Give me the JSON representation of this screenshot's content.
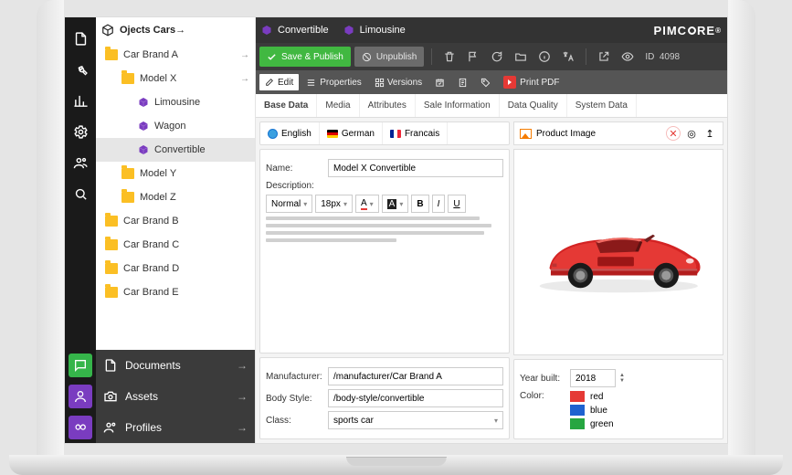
{
  "brand": "PIMCORE",
  "rail": {
    "items": [
      "file",
      "wrench",
      "chart",
      "settings",
      "users",
      "search"
    ],
    "bottom": [
      {
        "icon": "message",
        "color": "#35b54a"
      },
      {
        "icon": "user",
        "color": "#7a3cc0"
      },
      {
        "icon": "infinity",
        "color": "#7a3cc0"
      }
    ]
  },
  "tree": {
    "root": "Ojects Cars",
    "brand_a": "Car Brand A",
    "model_x": "Model X",
    "variants": [
      "Limousine",
      "Wagon",
      "Convertible"
    ],
    "models": [
      "Model Y",
      "Model Z"
    ],
    "brands": [
      "Car Brand B",
      "Car Brand C",
      "Car Brand D",
      "Car Brand E"
    ],
    "bottom": [
      {
        "label": "Documents",
        "icon": "document",
        "color": "#3b3b3b"
      },
      {
        "label": "Assets",
        "icon": "camera",
        "color": "#3b3b3b"
      },
      {
        "label": "Profiles",
        "icon": "profiles",
        "color": "#3b3b3b"
      }
    ]
  },
  "open_tabs": [
    "Convertible",
    "Limousine"
  ],
  "toolbar": {
    "save": "Save & Publish",
    "unpublish": "Unpublish",
    "id_label": "ID",
    "id_value": "4098"
  },
  "toolbar2": {
    "edit": "Edit",
    "properties": "Properties",
    "versions": "Versions",
    "print_pdf": "Print PDF"
  },
  "subtabs": [
    "Base Data",
    "Media",
    "Attributes",
    "Sale Information",
    "Data Quality",
    "System Data"
  ],
  "langs": {
    "en": "English",
    "de": "German",
    "fr": "Francais"
  },
  "form": {
    "name_label": "Name:",
    "name_value": "Model X Convertible",
    "desc_label": "Description:",
    "normal": "Normal",
    "size": "18px"
  },
  "image_panel": {
    "title": "Product Image"
  },
  "details": {
    "manufacturer_label": "Manufacturer:",
    "manufacturer_value": "/manufacturer/Car Brand A",
    "body_label": "Body Style:",
    "body_value": "/body-style/convertible",
    "class_label": "Class:",
    "class_value": "sports car",
    "year_label": "Year built:",
    "year_value": "2018",
    "color_label": "Color:",
    "colors": [
      {
        "name": "red",
        "hex": "#e53935"
      },
      {
        "name": "blue",
        "hex": "#1e62d0"
      },
      {
        "name": "green",
        "hex": "#26a641"
      }
    ]
  }
}
